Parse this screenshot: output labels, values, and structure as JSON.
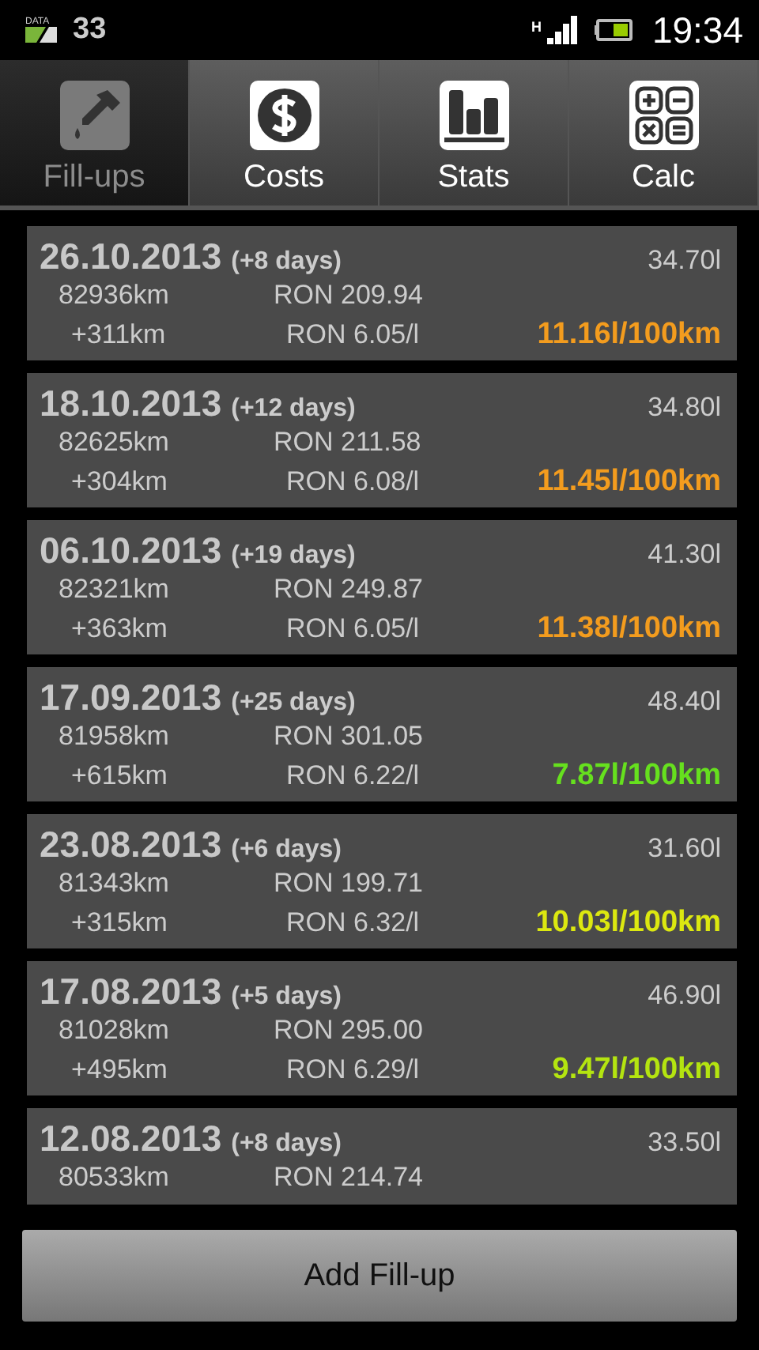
{
  "status_bar": {
    "data_label": "DATA",
    "notification_count": "33",
    "network_type": "H",
    "time": "19:34"
  },
  "tabs": [
    {
      "label": "Fill-ups",
      "kind": "dropper",
      "selected": true
    },
    {
      "label": "Costs",
      "kind": "dollar",
      "selected": false
    },
    {
      "label": "Stats",
      "kind": "chart",
      "selected": false
    },
    {
      "label": "Calc",
      "kind": "calculator",
      "selected": false
    }
  ],
  "fillups": [
    {
      "date": "26.10.2013",
      "interval": "(+8 days)",
      "volume": "34.70l",
      "odometer": "82936km",
      "price": "RON 209.94",
      "distance": "+311km",
      "unit_price": "RON 6.05/l",
      "consumption": "11.16l/100km",
      "color": "#f39c1e"
    },
    {
      "date": "18.10.2013",
      "interval": "(+12 days)",
      "volume": "34.80l",
      "odometer": "82625km",
      "price": "RON 211.58",
      "distance": "+304km",
      "unit_price": "RON 6.08/l",
      "consumption": "11.45l/100km",
      "color": "#f39c1e"
    },
    {
      "date": "06.10.2013",
      "interval": "(+19 days)",
      "volume": "41.30l",
      "odometer": "82321km",
      "price": "RON 249.87",
      "distance": "+363km",
      "unit_price": "RON 6.05/l",
      "consumption": "11.38l/100km",
      "color": "#f39c1e"
    },
    {
      "date": "17.09.2013",
      "interval": "(+25 days)",
      "volume": "48.40l",
      "odometer": "81958km",
      "price": "RON 301.05",
      "distance": "+615km",
      "unit_price": "RON 6.22/l",
      "consumption": "7.87l/100km",
      "color": "#66e01e"
    },
    {
      "date": "23.08.2013",
      "interval": "(+6 days)",
      "volume": "31.60l",
      "odometer": "81343km",
      "price": "RON 199.71",
      "distance": "+315km",
      "unit_price": "RON 6.32/l",
      "consumption": "10.03l/100km",
      "color": "#dce810"
    },
    {
      "date": "17.08.2013",
      "interval": "(+5 days)",
      "volume": "46.90l",
      "odometer": "81028km",
      "price": "RON 295.00",
      "distance": "+495km",
      "unit_price": "RON 6.29/l",
      "consumption": "9.47l/100km",
      "color": "#b4e410"
    },
    {
      "date": "12.08.2013",
      "interval": "(+8 days)",
      "volume": "33.50l",
      "odometer": "80533km",
      "price": "RON 214.74"
    }
  ],
  "add_button": {
    "label": "Add Fill-up"
  }
}
